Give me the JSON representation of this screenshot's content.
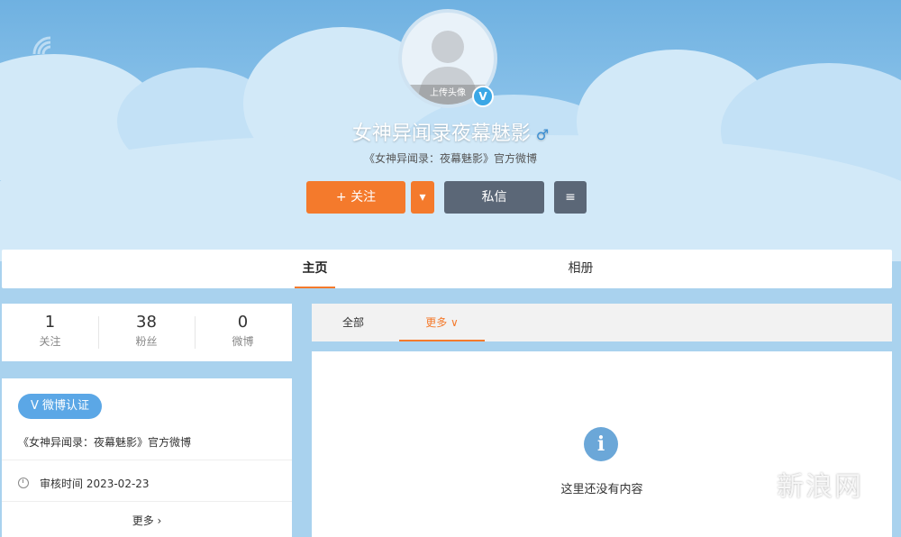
{
  "profile": {
    "avatar_caption": "上传头像",
    "verify_mark": "V",
    "name": "女神异闻录夜幕魅影",
    "gender_symbol": "♂",
    "description": "《女神异闻录：夜幕魅影》官方微博"
  },
  "actions": {
    "follow_label": "+ 关注",
    "dropdown_icon": "▾",
    "message_label": "私信",
    "menu_icon": "≡"
  },
  "tabs": {
    "home": "主页",
    "album": "相册"
  },
  "stats": [
    {
      "num": "1",
      "label": "关注"
    },
    {
      "num": "38",
      "label": "粉丝"
    },
    {
      "num": "0",
      "label": "微博"
    }
  ],
  "certification": {
    "badge": "V 微博认证",
    "desc": "《女神异闻录：夜幕魅影》官方微博",
    "review_time": "审核时间 2023-02-23",
    "more": "更多 ›"
  },
  "feed": {
    "tab_all": "全部",
    "tab_more": "更多 ∨",
    "info_icon": "i",
    "empty_text": "这里还没有内容"
  },
  "watermark": "新浪网",
  "colors": {
    "accent": "#f47a2c",
    "dark_button": "#5b6777",
    "verify_blue": "#3aa7e6",
    "sky": "#8cc3ea"
  }
}
